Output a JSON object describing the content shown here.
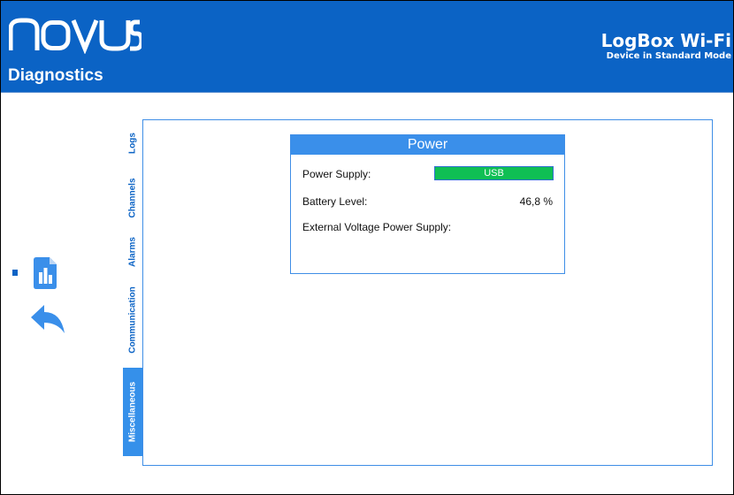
{
  "header": {
    "brand": "novus",
    "page_title": "Diagnostics",
    "product_name": "LogBox Wi-Fi",
    "device_mode": "Device in Standard Mode"
  },
  "left_nav": {
    "diagnostics_icon": "bar-chart-document-icon",
    "back_icon": "back-arrow-icon"
  },
  "tabs": [
    {
      "label": "Logs",
      "active": false
    },
    {
      "label": "Channels",
      "active": false
    },
    {
      "label": "Alarms",
      "active": false
    },
    {
      "label": "Communication",
      "active": false
    },
    {
      "label": "Miscellaneous",
      "active": true
    }
  ],
  "power": {
    "title": "Power",
    "supply_label": "Power Supply:",
    "supply_value": "USB",
    "battery_label": "Battery Level:",
    "battery_value": "46,8 %",
    "external_label": "External Voltage Power Supply:"
  },
  "colors": {
    "brand_blue": "#0b63c5",
    "tab_active": "#3590ea",
    "supply_ok_green": "#0fbf54"
  }
}
